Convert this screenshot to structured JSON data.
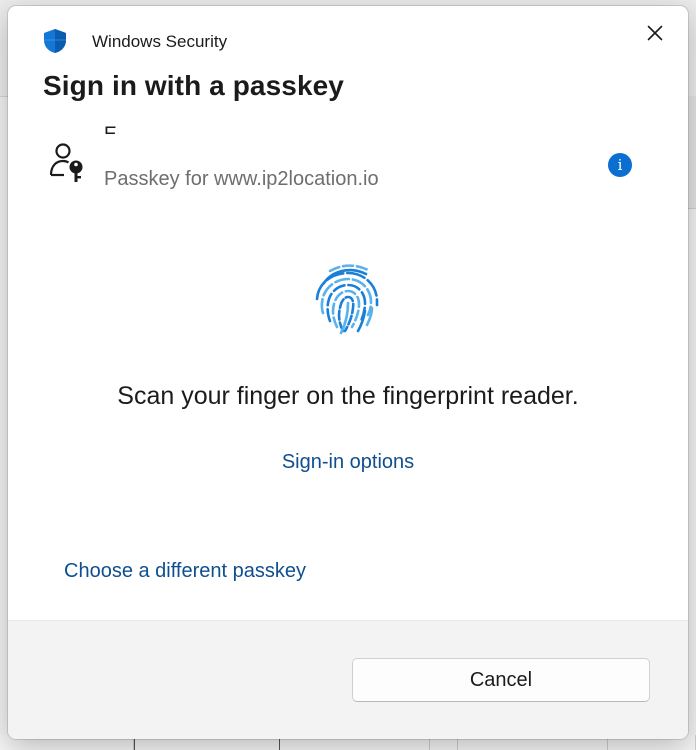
{
  "window": {
    "app_title": "Windows Security",
    "close_icon": "close-icon"
  },
  "dialog": {
    "heading": "Sign in with a passkey",
    "passkey": {
      "name": "E        .",
      "subtitle": "Passkey for www.ip2location.io",
      "icon": "key-user-icon",
      "info_icon": "info-icon",
      "info_glyph": "i"
    },
    "fingerprint_icon": "fingerprint-icon",
    "instruction": "Scan your finger on the fingerprint reader.",
    "sign_in_options": "Sign-in options",
    "choose_different": "Choose a different passkey",
    "cancel_label": "Cancel"
  },
  "colors": {
    "link": "#0f4f8f",
    "accent": "#0a6fd0",
    "shield": "#1477d6",
    "footer_bg": "#f3f3f3"
  }
}
